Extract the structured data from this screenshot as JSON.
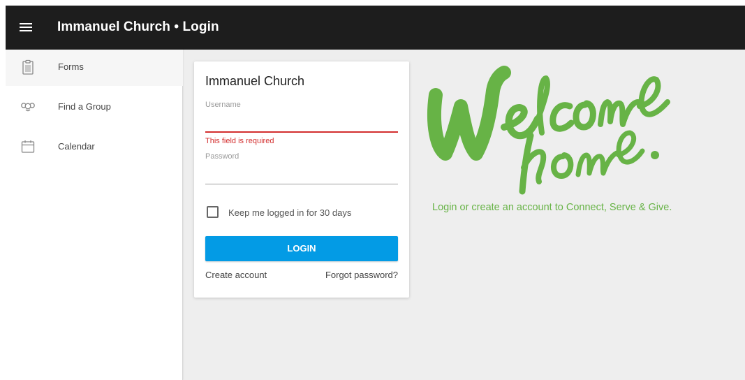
{
  "header": {
    "menu_icon": "hamburger-menu-icon",
    "title": "Immanuel Church • Login",
    "background": "#1d1d1d"
  },
  "sidebar": {
    "items": [
      {
        "label": "Forms",
        "icon": "clipboard-icon",
        "active": true
      },
      {
        "label": "Find a Group",
        "icon": "group-icon",
        "active": false
      },
      {
        "label": "Calendar",
        "icon": "calendar-icon",
        "active": false
      }
    ]
  },
  "login_card": {
    "title": "Immanuel Church",
    "username": {
      "label": "Username",
      "value": "",
      "error": "This field is required"
    },
    "password": {
      "label": "Password",
      "value": ""
    },
    "remember_label": "Keep me logged in for 30 days",
    "remember_checked": false,
    "login_button": "LOGIN",
    "create_account": "Create account",
    "forgot_password": "Forgot password?"
  },
  "welcome": {
    "logo_lettering": "Welcome home.",
    "tagline": "Login or create an account to Connect, Serve & Give."
  },
  "colors": {
    "accent_blue": "#039be5",
    "error_red": "#d32f2f",
    "brand_green": "#67b346",
    "background": "#eeeeee"
  }
}
